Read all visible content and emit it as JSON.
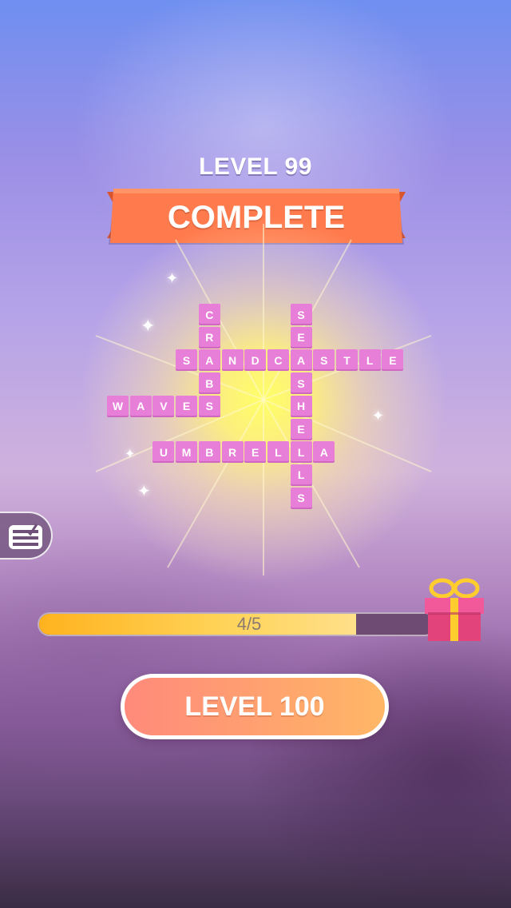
{
  "header": {
    "level_label": "LEVEL 99",
    "banner_label": "COMPLETE"
  },
  "puzzle": {
    "words": [
      {
        "word": "CRABS",
        "direction": "down"
      },
      {
        "word": "SANDCASTLE",
        "direction": "across"
      },
      {
        "word": "WAVES",
        "direction": "across"
      },
      {
        "word": "UMBRELLA",
        "direction": "across"
      },
      {
        "word": "SEASHELLS",
        "direction": "down"
      }
    ],
    "tile_color": "#e77fd9"
  },
  "progress": {
    "label": "4/5",
    "current": 4,
    "total": 5
  },
  "next_button": {
    "label": "LEVEL 100"
  },
  "icons": {
    "side_tab": "checklist-icon",
    "reward": "gift-icon"
  },
  "colors": {
    "banner": "#ff7a4d",
    "button_start": "#ff8a7b",
    "button_end": "#ffb766",
    "progress_fill": "#ffc73a"
  }
}
